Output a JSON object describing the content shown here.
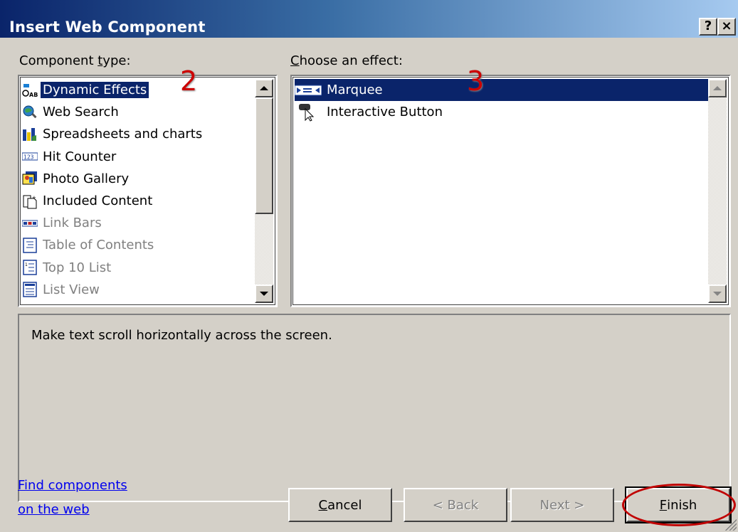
{
  "window": {
    "title": "Insert Web Component",
    "help_label": "?",
    "close_label": "×"
  },
  "component_type": {
    "label_pre": "Component ",
    "label_ul": "t",
    "label_post": "ype:",
    "items": [
      {
        "label": "Dynamic Effects",
        "icon": "dynamic-effects-icon",
        "selected": true,
        "disabled": false
      },
      {
        "label": "Web Search",
        "icon": "web-search-icon",
        "selected": false,
        "disabled": false
      },
      {
        "label": "Spreadsheets and charts",
        "icon": "spreadsheet-chart-icon",
        "selected": false,
        "disabled": false
      },
      {
        "label": "Hit Counter",
        "icon": "hit-counter-icon",
        "selected": false,
        "disabled": false
      },
      {
        "label": "Photo Gallery",
        "icon": "photo-gallery-icon",
        "selected": false,
        "disabled": false
      },
      {
        "label": "Included Content",
        "icon": "included-content-icon",
        "selected": false,
        "disabled": false
      },
      {
        "label": "Link Bars",
        "icon": "link-bars-icon",
        "selected": false,
        "disabled": true
      },
      {
        "label": "Table of Contents",
        "icon": "table-of-contents-icon",
        "selected": false,
        "disabled": true
      },
      {
        "label": "Top 10 List",
        "icon": "top-10-list-icon",
        "selected": false,
        "disabled": true
      },
      {
        "label": "List View",
        "icon": "list-view-icon",
        "selected": false,
        "disabled": true
      }
    ]
  },
  "effect": {
    "label_pre": "",
    "label_ul": "C",
    "label_post": "hoose an effect:",
    "items": [
      {
        "label": "Marquee",
        "icon": "marquee-icon",
        "selected": true
      },
      {
        "label": "Interactive Button",
        "icon": "interactive-button-icon",
        "selected": false
      }
    ]
  },
  "annotations": {
    "step2": "2",
    "step3": "3"
  },
  "description": "Make text scroll horizontally across the screen.",
  "links": {
    "line1": "Find components",
    "line2": "on the web"
  },
  "buttons": {
    "cancel_ul": "C",
    "cancel_rest": "ancel",
    "back": "< Back",
    "next": "Next >",
    "finish_ul": "F",
    "finish_rest": "inish"
  },
  "colors": {
    "selection": "#0a246a",
    "face": "#d4d0c8",
    "annotation": "#cc0000"
  }
}
